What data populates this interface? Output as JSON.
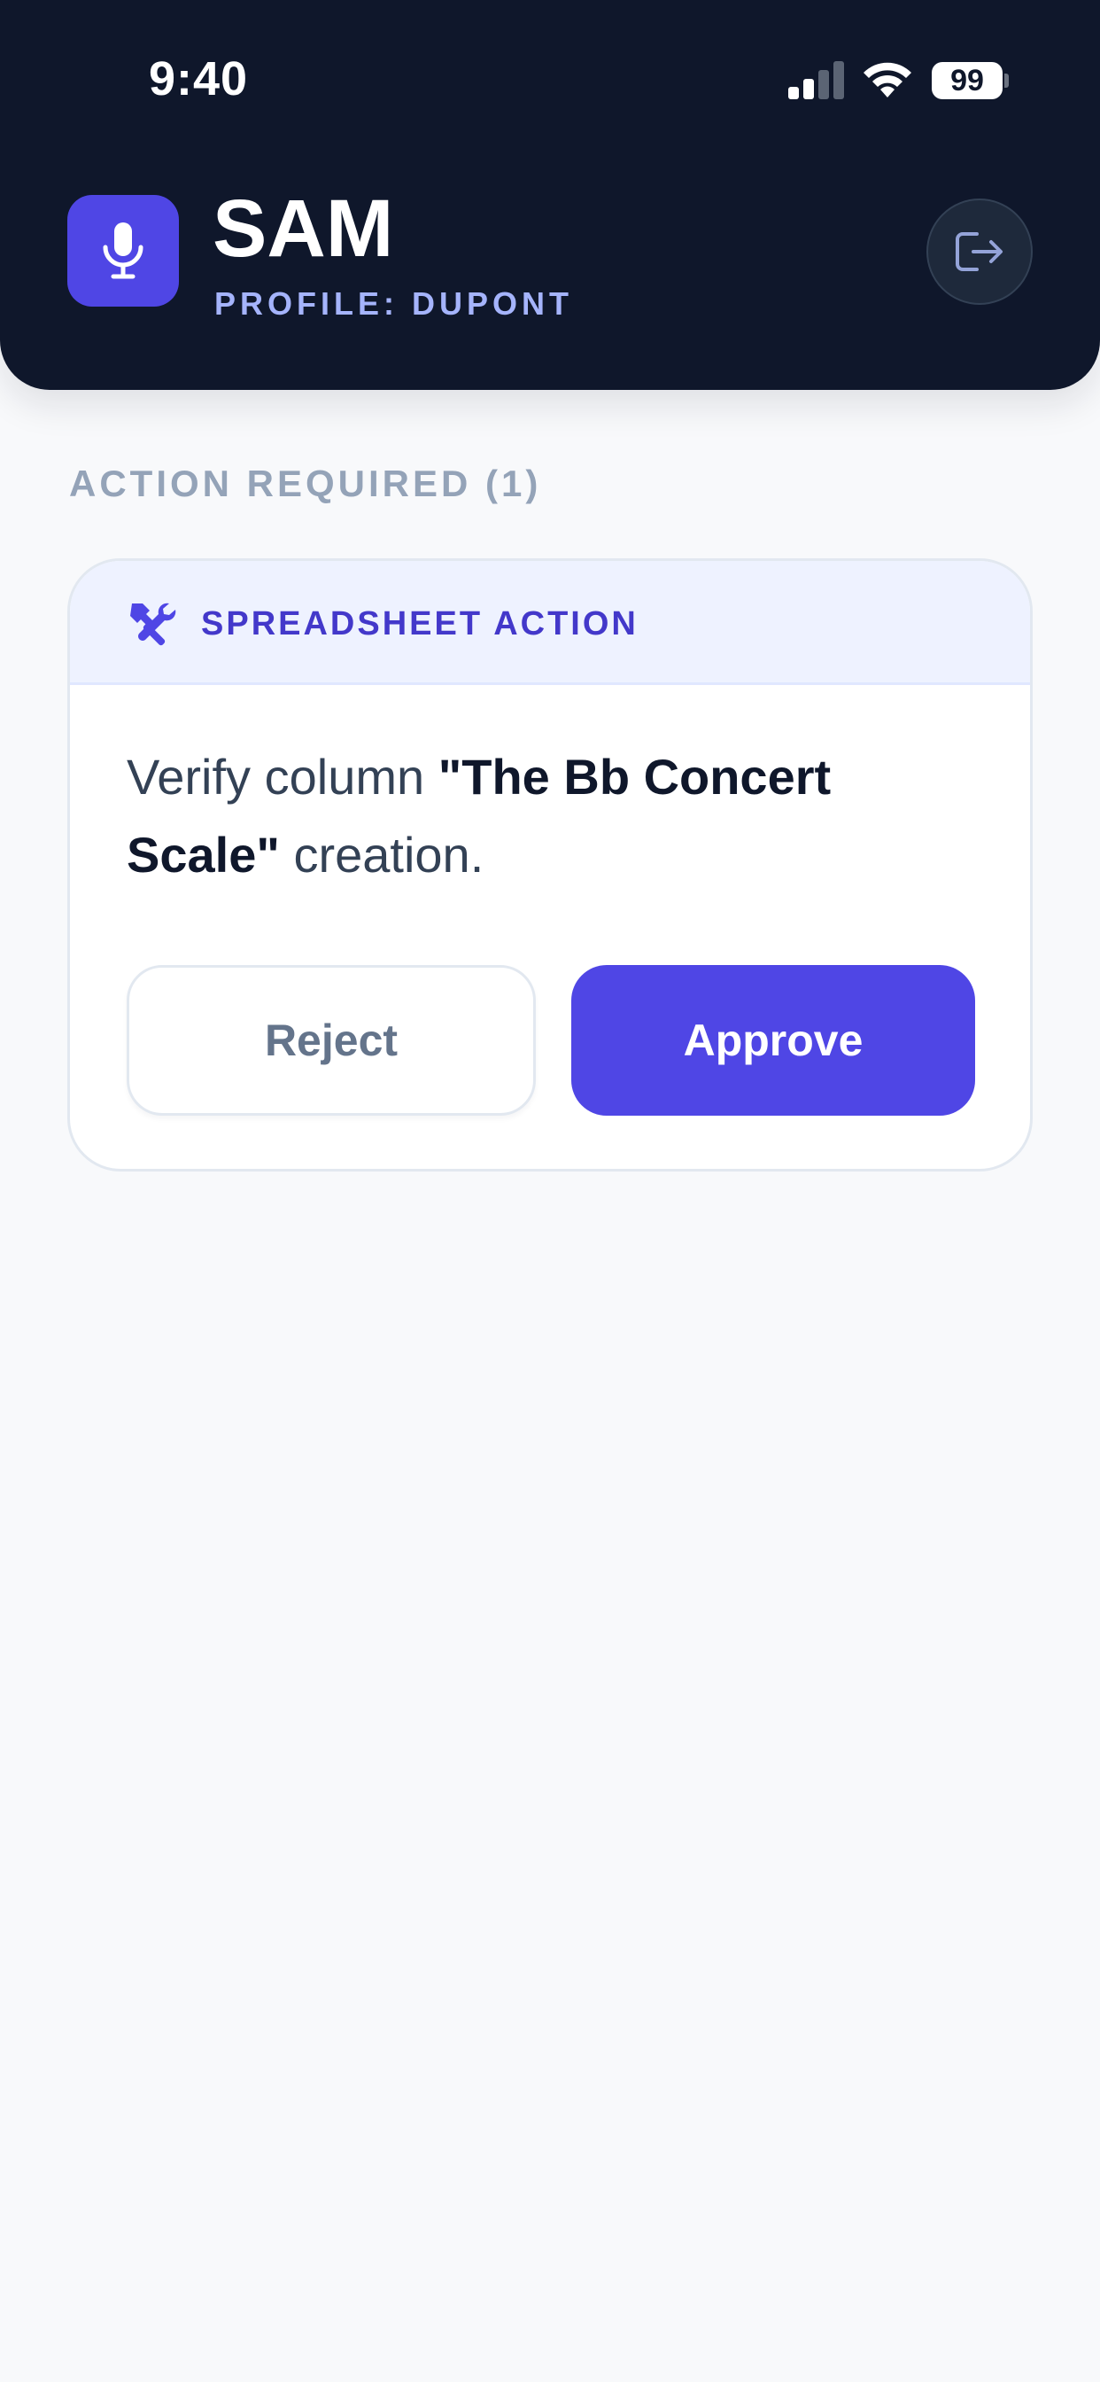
{
  "status_bar": {
    "time": "9:40",
    "battery": "99",
    "icons": [
      "signal-icon",
      "wifi-icon",
      "battery-icon"
    ]
  },
  "header": {
    "title": "SAM",
    "subtitle": "PROFILE: DUPONT",
    "logo_icon": "microphone-icon",
    "logout_icon": "logout-icon"
  },
  "section": {
    "heading": "ACTION REQUIRED (1)"
  },
  "card": {
    "icon": "tools-icon",
    "label": "SPREADSHEET ACTION",
    "message_prefix": "Verify column ",
    "message_bold": "\"The Bb Concert Scale\"",
    "message_suffix": " creation.",
    "reject_label": "Reject",
    "approve_label": "Approve"
  },
  "colors": {
    "header_bg": "#0f172b",
    "accent": "#4f46e5",
    "subtitle": "#a5b4fc",
    "page_bg": "#f8f9fb",
    "card_header_bg": "#eef2ff"
  }
}
